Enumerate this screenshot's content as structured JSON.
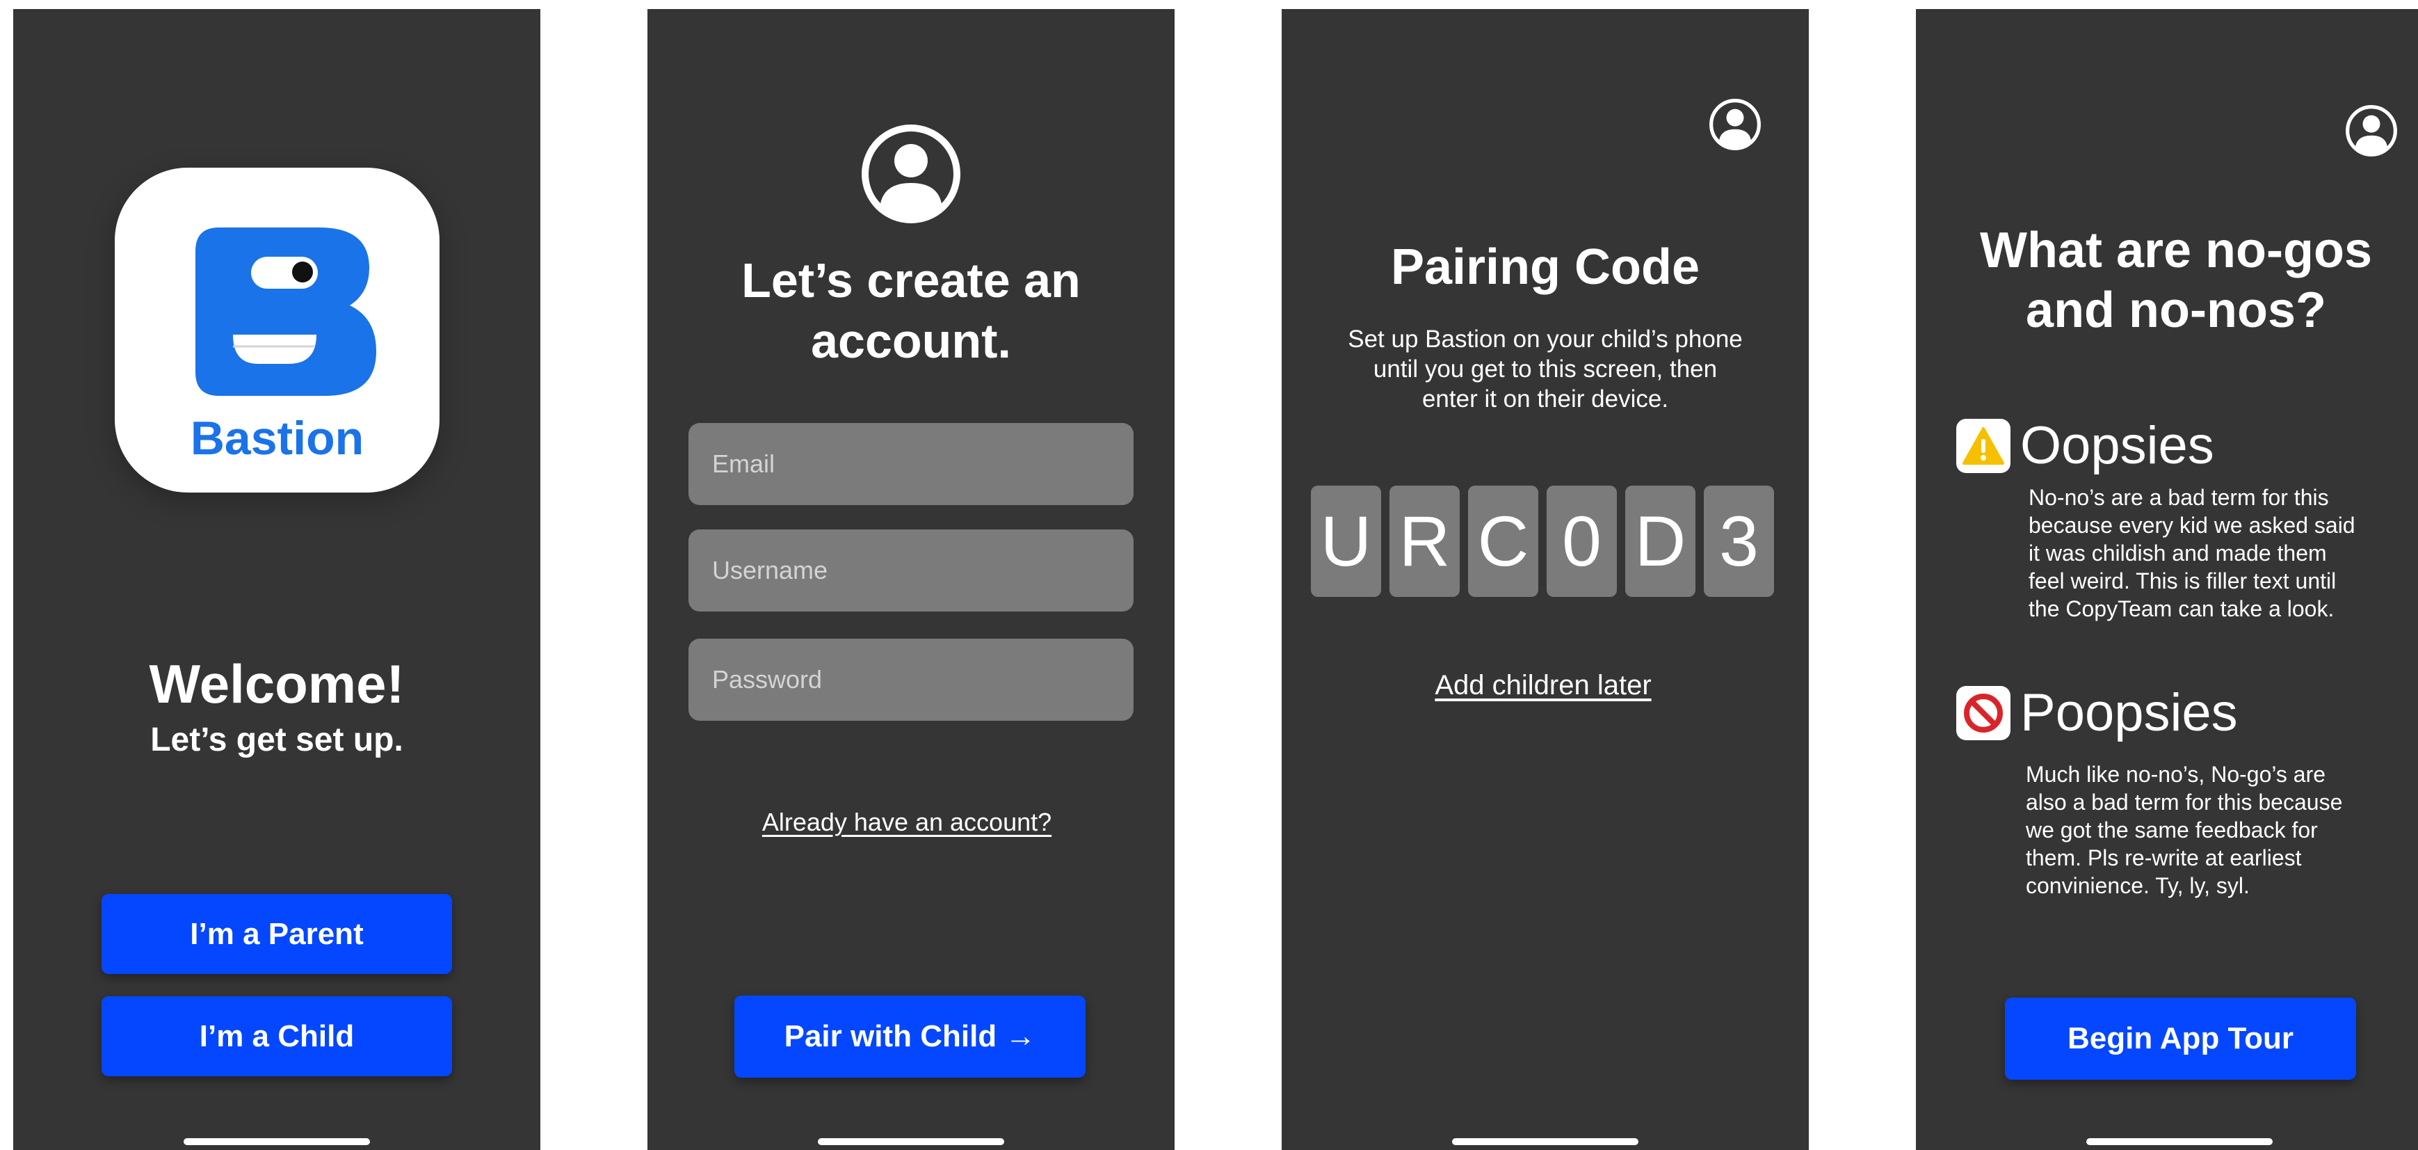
{
  "colors": {
    "screen_bg": "#353535",
    "accent": "#0447ff",
    "logo_blue": "#1a73e8",
    "field_bg": "#7b7b7b",
    "warning_yellow": "#f6c000",
    "stop_red": "#d9252a"
  },
  "welcome_screen": {
    "logo_label": "Bastion",
    "title": "Welcome!",
    "subtitle": "Let’s get set up.",
    "parent_button": "I’m a Parent",
    "child_button": "I’m a Child"
  },
  "signup_screen": {
    "avatar_icon": "user-circle-icon",
    "title_line1": "Let’s create an",
    "title_line2": "account.",
    "email_placeholder": "Email",
    "username_placeholder": "Username",
    "password_placeholder": "Password",
    "login_link": "Already have an account?",
    "pair_button": "Pair with Child →"
  },
  "pairing_screen": {
    "profile_icon": "user-circle-icon",
    "title": "Pairing Code",
    "instructions_line1": "Set up Bastion on your child’s phone",
    "instructions_line2": "until you get to this screen, then",
    "instructions_line3": "enter it on their device.",
    "code": [
      "U",
      "R",
      "C",
      "0",
      "D",
      "3"
    ],
    "later_link": "Add children later"
  },
  "rules_screen": {
    "profile_icon": "user-circle-icon",
    "title_line1": "What are no-gos",
    "title_line2": "and no-nos?",
    "sections": [
      {
        "icon": "warning-icon",
        "title": "Oopsies",
        "lines": [
          "No-no’s are a bad term for this",
          "because every kid we asked said",
          "it was childish and made them",
          "feel weird. This is filler text until",
          "the CopyTeam can take a look."
        ]
      },
      {
        "icon": "prohibited-icon",
        "title": "Poopsies",
        "lines": [
          "Much like no-no’s, No-go’s are",
          "also a bad term for this because",
          "we got the same feedback for",
          "them. Pls re-write at earliest",
          "convinience. Ty, ly, syl."
        ]
      }
    ],
    "tour_button": "Begin App Tour"
  }
}
